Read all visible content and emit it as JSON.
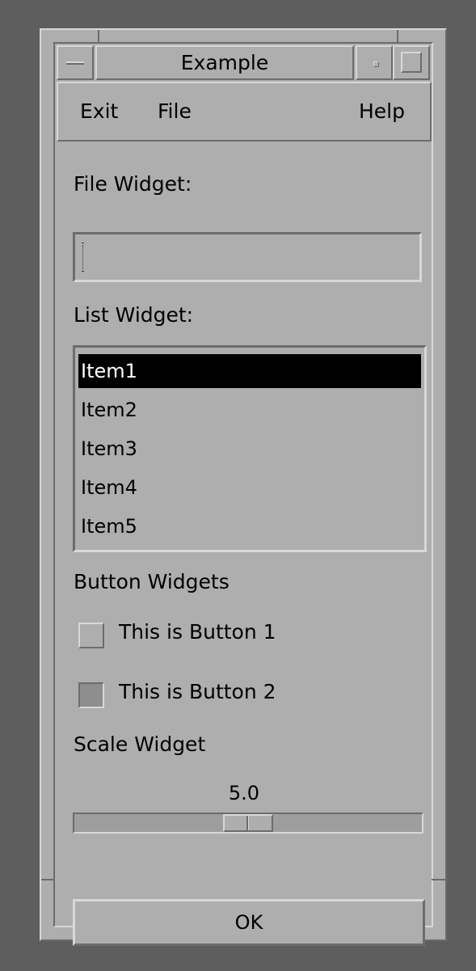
{
  "window": {
    "title": "Example",
    "icons": {
      "menu": "window-menu-icon",
      "minimize": "minimize-icon",
      "maximize": "maximize-icon"
    }
  },
  "menubar": {
    "exit": "Exit",
    "file": "File",
    "help": "Help"
  },
  "file_widget": {
    "label": "File Widget:",
    "value": ""
  },
  "list_widget": {
    "label": "List Widget:",
    "items": [
      "Item1",
      "Item2",
      "Item3",
      "Item4",
      "Item5"
    ],
    "selected_index": 0
  },
  "buttons": {
    "label": "Button Widgets",
    "button1": {
      "label": "This is Button 1",
      "checked": false
    },
    "button2": {
      "label": "This is Button 2",
      "checked": true
    }
  },
  "scale": {
    "label": "Scale Widget",
    "value_text": "5.0",
    "value": 5.0,
    "min": 0,
    "max": 10
  },
  "ok_button": {
    "label": "OK"
  },
  "colors": {
    "background": "#aeaeae",
    "desktop": "#5e5e5e",
    "selection": "#000000"
  }
}
